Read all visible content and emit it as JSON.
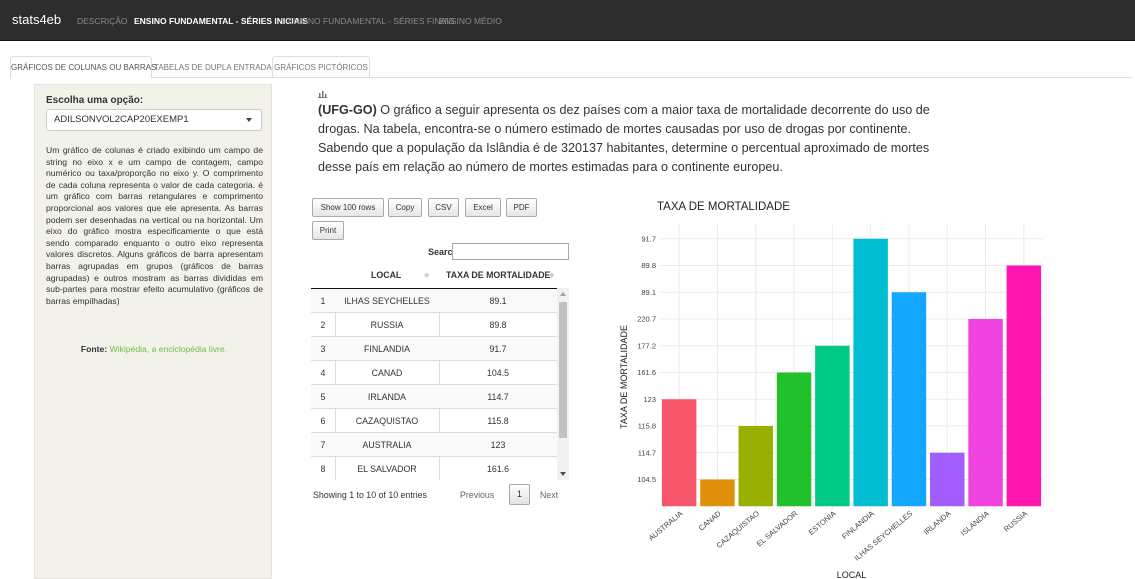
{
  "app": {
    "brand": "stats4eb",
    "nav": [
      {
        "label": "DESCRIÇÃO",
        "active": false
      },
      {
        "label": "ENSINO FUNDAMENTAL - SÉRIES INICIAIS",
        "active": true
      },
      {
        "label": "ENSINO FUNDAMENTAL - SÉRIES FINAIS",
        "active": false
      },
      {
        "label": "ENSINO MÉDIO",
        "active": false
      }
    ]
  },
  "tabs": [
    {
      "label": "GRÁFICOS DE COLUNAS OU BARRAS",
      "active": true
    },
    {
      "label": "TABELAS DE DUPLA ENTRADA",
      "active": false
    },
    {
      "label": "GRÁFICOS PICTÓRICOS",
      "active": false
    }
  ],
  "sidebar": {
    "label": "Escolha uma opção:",
    "selected": "ADILSONVOL2CAP20EXEMP1",
    "description": "Um gráfico de colunas é criado exibindo um campo de string no eixo x e um campo de contagem, campo numérico ou taxa/proporção no eixo y. O comprimento de cada coluna representa o valor de cada categoria. é um gráfico com barras retangulares e comprimento proporcional aos valores que ele apresenta. As barras podem ser desenhadas na vertical ou na horizontal. Um eixo do gráfico mostra especificamente o que está sendo comparado enquanto o outro eixo representa valores discretos. Alguns gráficos de barra apresentam barras agrupadas em grupos (gráficos de barras agrupadas) e outros mostram as barras divididas em sub-partes para mostrar efeito acumulativo (gráficos de barras empilhadas)",
    "source_label": "Fonte:",
    "source_link": "Wikipédia, a enciclopédia livre."
  },
  "question": {
    "icon": "bar-chart-icon",
    "tag": "(UFG-GO)",
    "text": " O gráfico a seguir apresenta os dez países com a maior taxa de mortalidade decorrente do uso de drogas. Na tabela, encontra-se o número estimado de mortes causadas por uso de drogas por continente. Sabendo que a população da Islândia é de 320137 habitantes, determine o percentual aproximado de mortes desse país em relação ao número de mortes estimadas para o continente europeu."
  },
  "table": {
    "buttons": {
      "show": "Show 100 rows",
      "copy": "Copy",
      "csv": "CSV",
      "excel": "Excel",
      "pdf": "PDF",
      "print": "Print"
    },
    "search_label": "Search:",
    "columns": [
      "LOCAL",
      "TAXA DE MORTALIDADE"
    ],
    "rows": [
      [
        "1",
        "ILHAS SEYCHELLES",
        "89.1"
      ],
      [
        "2",
        "RUSSIA",
        "89.8"
      ],
      [
        "3",
        "FINLANDIA",
        "91.7"
      ],
      [
        "4",
        "CANAD",
        "104.5"
      ],
      [
        "5",
        "IRLANDA",
        "114.7"
      ],
      [
        "6",
        "CAZAQUISTAO",
        "115.8"
      ],
      [
        "7",
        "AUSTRALIA",
        "123"
      ],
      [
        "8",
        "EL SALVADOR",
        "161.6"
      ]
    ],
    "info": "Showing 1 to 10 of 10 entries",
    "prev": "Previous",
    "page": "1",
    "next": "Next"
  },
  "chart_data": {
    "type": "bar",
    "title": "TAXA DE MORTALIDADE",
    "xlabel": "LOCAL",
    "ylabel": "TAXA DE MORTALIDADE",
    "y_axis": "categorical",
    "y_ticks": [
      "104.5",
      "114.7",
      "115.8",
      "123",
      "161.6",
      "177.2",
      "220.7",
      "89.1",
      "89.8",
      "91.7"
    ],
    "categories": [
      "AUSTRALIA",
      "CANAD",
      "CAZAQUISTAO",
      "EL SALVADOR",
      "ESTONIA",
      "FINLANDIA",
      "ILHAS SEYCHELLES",
      "IRLANDA",
      "ISLANDIA",
      "RUSSIA"
    ],
    "values": [
      "123",
      "104.5",
      "115.8",
      "161.6",
      "177.2",
      "91.7",
      "89.1",
      "114.7",
      "220.7",
      "89.8"
    ],
    "colors": [
      "#f8566b",
      "#e0900a",
      "#9ab000",
      "#22c02a",
      "#00c986",
      "#00bdd0",
      "#14a7ff",
      "#a25dff",
      "#ef43e0",
      "#ff15b0"
    ],
    "grid": true
  }
}
